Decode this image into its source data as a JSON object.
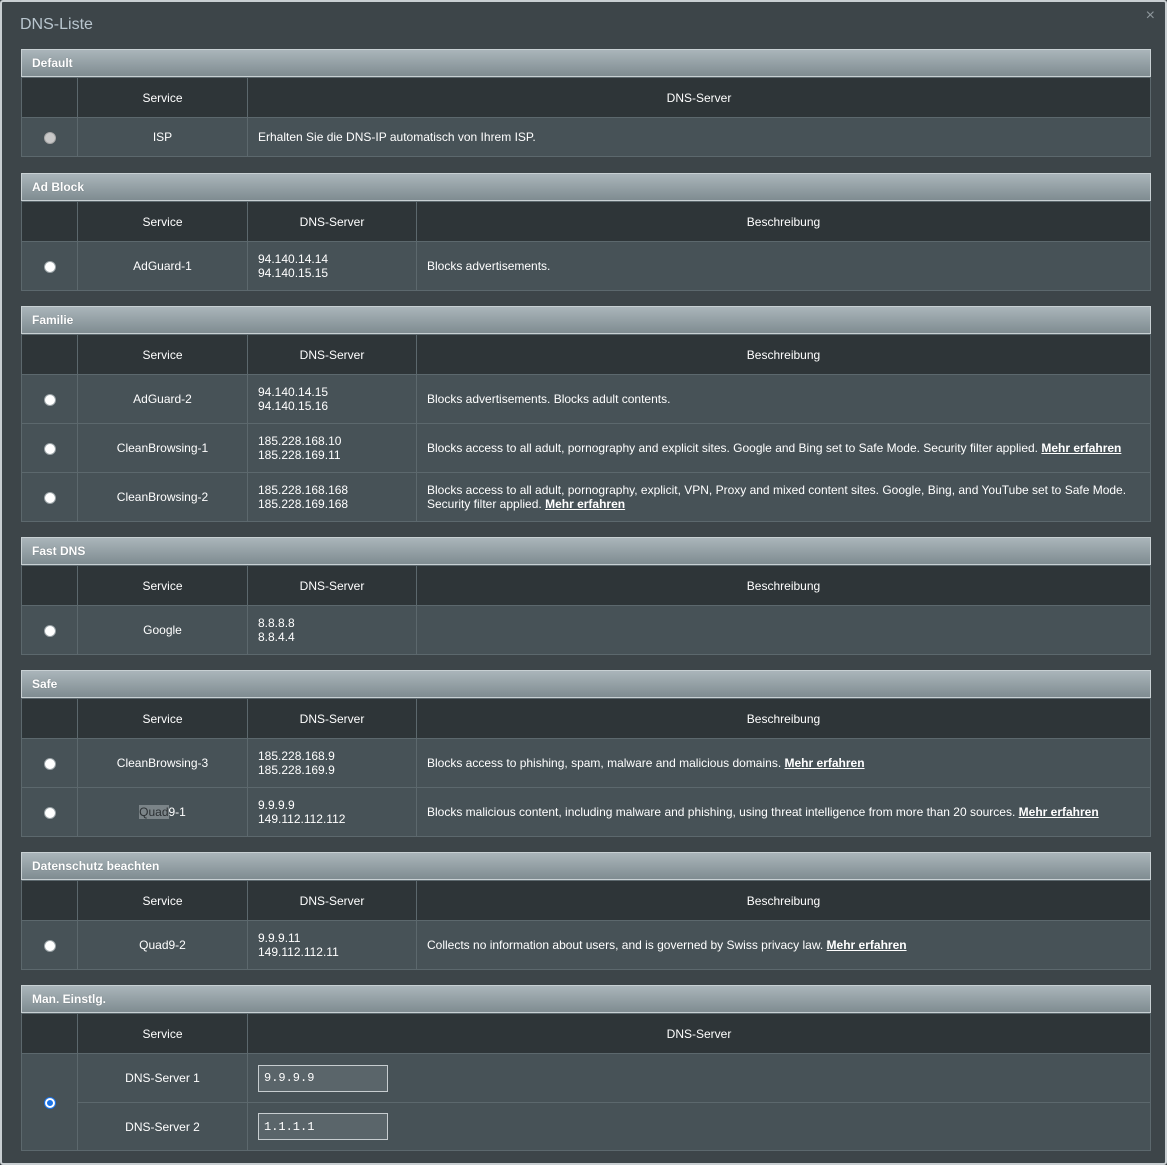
{
  "dialog": {
    "title": "DNS-Liste",
    "close": "×"
  },
  "columns": {
    "service": "Service",
    "dns_server": "DNS-Server",
    "description": "Beschreibung"
  },
  "more_label": "Mehr erfahren",
  "sections": {
    "default": {
      "title": "Default",
      "rows": [
        {
          "service": "ISP",
          "dns": "Erhalten Sie die DNS-IP automatisch von Ihrem ISP."
        }
      ]
    },
    "adblock": {
      "title": "Ad Block",
      "rows": [
        {
          "service": "AdGuard-1",
          "dns1": "94.140.14.14",
          "dns2": "94.140.15.15",
          "desc": "Blocks advertisements."
        }
      ]
    },
    "familie": {
      "title": "Familie",
      "rows": [
        {
          "service": "AdGuard-2",
          "dns1": "94.140.14.15",
          "dns2": "94.140.15.16",
          "desc": "Blocks advertisements. Blocks adult contents."
        },
        {
          "service": "CleanBrowsing-1",
          "dns1": "185.228.168.10",
          "dns2": "185.228.169.11",
          "desc": "Blocks access to all adult, pornography and explicit sites. Google and Bing set to Safe Mode. Security filter applied."
        },
        {
          "service": "CleanBrowsing-2",
          "dns1": "185.228.168.168",
          "dns2": "185.228.169.168",
          "desc": "Blocks access to all adult, pornography, explicit, VPN, Proxy and mixed content sites. Google, Bing, and YouTube set to Safe Mode. Security filter applied."
        }
      ]
    },
    "fastdns": {
      "title": "Fast DNS",
      "rows": [
        {
          "service": "Google",
          "dns1": "8.8.8.8",
          "dns2": "8.8.4.4",
          "desc": ""
        }
      ]
    },
    "safe": {
      "title": "Safe",
      "rows": [
        {
          "service": "CleanBrowsing-3",
          "dns1": "185.228.168.9",
          "dns2": "185.228.169.9",
          "desc": "Blocks access to phishing, spam, malware and malicious domains."
        },
        {
          "service_a": "Quad",
          "service_b": "9-1",
          "dns1": "9.9.9.9",
          "dns2": "149.112.112.112",
          "desc": "Blocks malicious content, including malware and phishing, using threat intelligence from more than 20 sources."
        }
      ]
    },
    "privacy": {
      "title": "Datenschutz beachten",
      "rows": [
        {
          "service": "Quad9-2",
          "dns1": "9.9.9.11",
          "dns2": "149.112.112.11",
          "desc": "Collects no information about users, and is governed by Swiss privacy law."
        }
      ]
    },
    "manual": {
      "title": "Man. Einstlg.",
      "rows": [
        {
          "service": "DNS-Server 1",
          "value": "9.9.9.9"
        },
        {
          "service": "DNS-Server 2",
          "value": "1.1.1.1"
        }
      ]
    }
  },
  "colors": {
    "background": "#3d4549",
    "header_bar": "#8f9ca1",
    "column_header": "#2e3538",
    "row": "#475257",
    "selected_radio": "#1a73e8"
  }
}
